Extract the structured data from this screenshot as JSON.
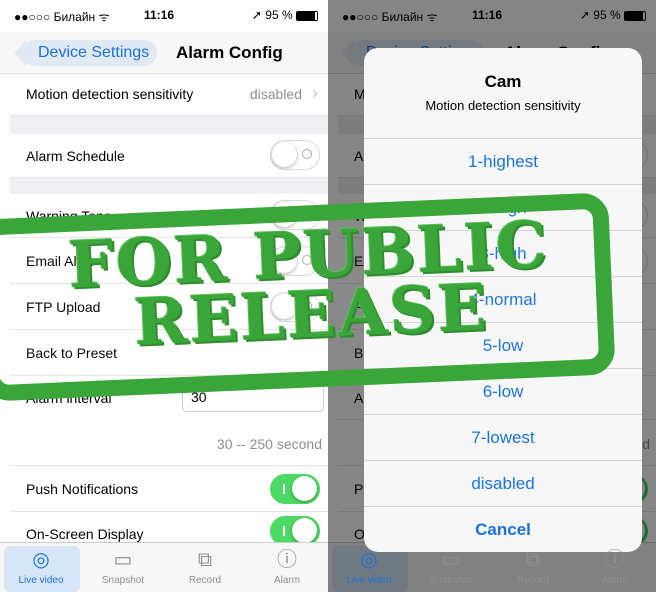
{
  "status": {
    "carrier": "●●○○○ Билайн",
    "wifi": "ᯤ",
    "time": "11:16",
    "battery": "95 %",
    "location_arrow": "➚"
  },
  "nav": {
    "back_label": "Device Settings",
    "title": "Alarm Config"
  },
  "settings": {
    "motion": {
      "label": "Motion detection sensitivity",
      "value": "disabled"
    },
    "alarm_schedule": {
      "label": "Alarm Schedule"
    },
    "warning_tone": {
      "label": "Warning Tone"
    },
    "email_alert": {
      "label": "Email Alert"
    },
    "ftp_upload": {
      "label": "FTP Upload"
    },
    "back_to_preset": {
      "label": "Back to Preset"
    },
    "alarm_interval": {
      "label": "Alarm interval",
      "value": "30",
      "hint": "30 -- 250 second"
    },
    "push_notifications": {
      "label": "Push Notifications"
    },
    "onscreen_display": {
      "label": "On-Screen Display"
    }
  },
  "tabs": [
    {
      "label": "Live video",
      "icon": "camera-lens-icon"
    },
    {
      "label": "Snapshot",
      "icon": "image-icon"
    },
    {
      "label": "Record",
      "icon": "video-camera-icon"
    },
    {
      "label": "Alarm",
      "icon": "alert-icon"
    }
  ],
  "alert": {
    "title": "Cam",
    "message": "Motion detection sensitivity",
    "options": [
      "1-highest",
      "2-high",
      "3-high",
      "4-normal",
      "5-low",
      "6-low",
      "7-lowest",
      "disabled"
    ],
    "cancel": "Cancel"
  },
  "stamp": {
    "line1": "FOR PUBLIC",
    "line2": "RELEASE",
    "color": "#3aa63a"
  },
  "colors": {
    "accent": "#1a73d9",
    "toggle_on": "#4cd964"
  }
}
